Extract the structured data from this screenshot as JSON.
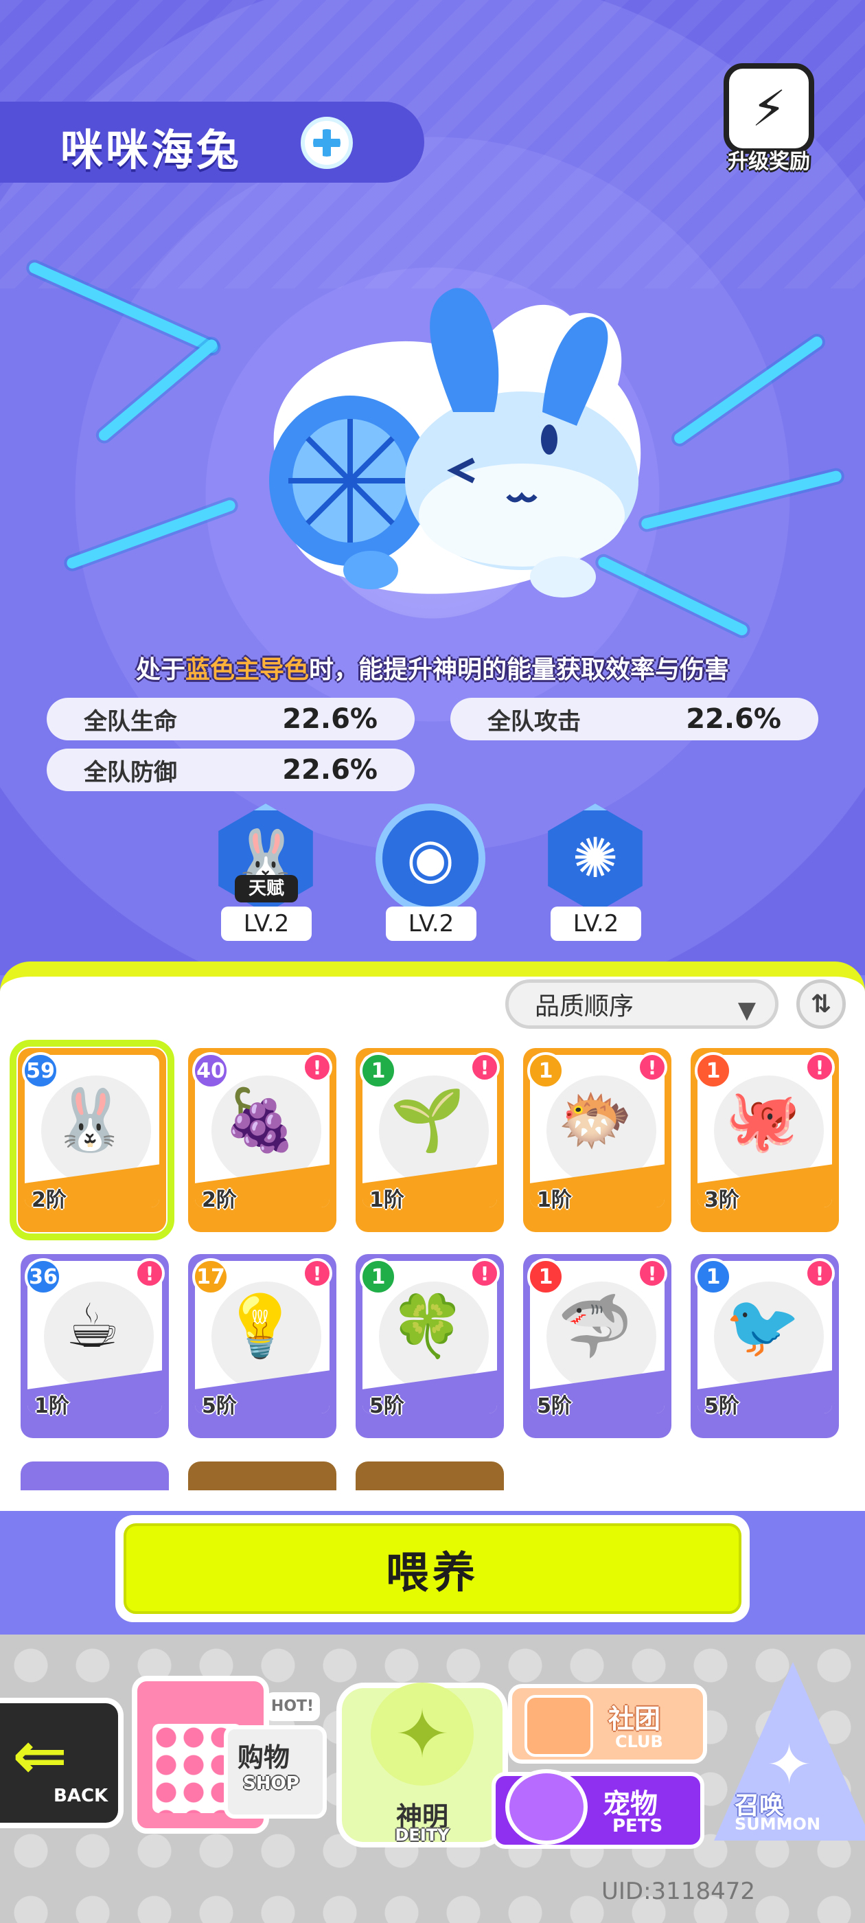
{
  "header": {
    "title": "咪咪海兔",
    "upgrade_label": "升级奖励"
  },
  "pet": {
    "description_prefix": "处于",
    "description_highlight": "蓝色主导色",
    "description_suffix": "时，能提升神明的能量获取效率与伤害",
    "stats": [
      {
        "label": "全队生命",
        "value": "22.6%"
      },
      {
        "label": "全队攻击",
        "value": "22.6%"
      },
      {
        "label": "全队防御",
        "value": "22.6%"
      }
    ],
    "skills": [
      {
        "tag": "天赋",
        "level": "LV.2",
        "icon": "bunny-icon"
      },
      {
        "tag": "",
        "level": "LV.2",
        "icon": "bubble-icon"
      },
      {
        "tag": "",
        "level": "LV.2",
        "icon": "pom-pom-icon"
      }
    ]
  },
  "list": {
    "sort_label": "品质顺序",
    "cards": [
      {
        "level": "59",
        "rank": "2阶",
        "frame": "orange",
        "badge_color": "#2b7ff0",
        "alert": false,
        "selected": true,
        "icon": "sea-bunny-icon",
        "glyph": "🐰"
      },
      {
        "level": "40",
        "rank": "2阶",
        "frame": "orange",
        "badge_color": "#8e5ee8",
        "alert": true,
        "selected": false,
        "icon": "grape-thunder-icon",
        "glyph": "🍇"
      },
      {
        "level": "1",
        "rank": "1阶",
        "frame": "orange",
        "badge_color": "#1fae48",
        "alert": true,
        "selected": false,
        "icon": "leaf-sprite-icon",
        "glyph": "🌱"
      },
      {
        "level": "1",
        "rank": "1阶",
        "frame": "orange",
        "badge_color": "#f6a316",
        "alert": true,
        "selected": false,
        "icon": "golden-puffer-icon",
        "glyph": "🐡"
      },
      {
        "level": "1",
        "rank": "3阶",
        "frame": "orange",
        "badge_color": "#ff5a30",
        "alert": true,
        "selected": false,
        "icon": "angry-octopus-icon",
        "glyph": "🐙"
      },
      {
        "level": "36",
        "rank": "1阶",
        "frame": "purple",
        "badge_color": "#2b7ff0",
        "alert": true,
        "selected": false,
        "icon": "cup-spirit-icon",
        "glyph": "☕"
      },
      {
        "level": "17",
        "rank": "5阶",
        "frame": "purple",
        "badge_color": "#f6a316",
        "alert": true,
        "selected": false,
        "icon": "lightbulb-icon",
        "glyph": "💡"
      },
      {
        "level": "1",
        "rank": "5阶",
        "frame": "purple",
        "badge_color": "#1fae48",
        "alert": true,
        "selected": false,
        "icon": "sprout-icon",
        "glyph": "🍀"
      },
      {
        "level": "1",
        "rank": "5阶",
        "frame": "purple",
        "badge_color": "#ff3a3a",
        "alert": true,
        "selected": false,
        "icon": "red-shark-icon",
        "glyph": "🦈"
      },
      {
        "level": "1",
        "rank": "5阶",
        "frame": "purple",
        "badge_color": "#2b7ff0",
        "alert": true,
        "selected": false,
        "icon": "blue-bird-icon",
        "glyph": "🐦"
      }
    ]
  },
  "feed_button": "喂养",
  "nav": {
    "back": "BACK",
    "shop_big": "购物",
    "shop_en": "SHOP",
    "shop_hot": "HOT!",
    "deity_big": "神明",
    "deity_en": "DEITY",
    "club_big": "社团",
    "club_en": "CLUB",
    "pets_big": "宠物",
    "pets_en": "PETS",
    "summon_big": "召唤",
    "summon_en": "SUMMON"
  },
  "uid": "UID:3118472"
}
